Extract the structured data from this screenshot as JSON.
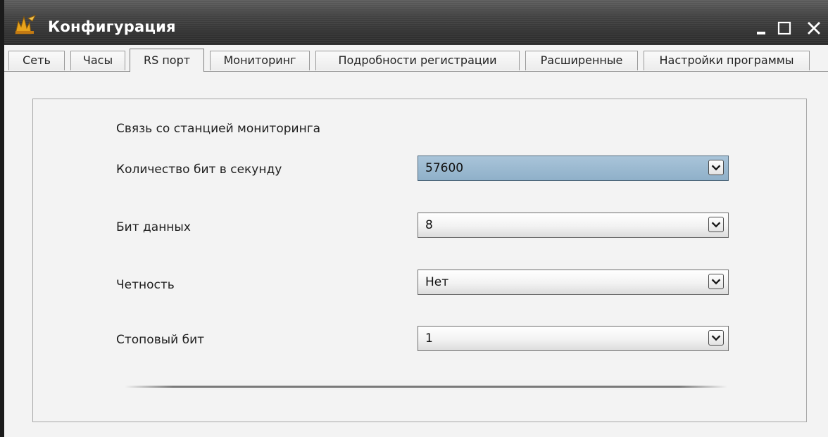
{
  "window": {
    "title": "Конфигурация",
    "accent_color": "#2b2b2b"
  },
  "tabs": [
    {
      "label": "Сеть",
      "active": false
    },
    {
      "label": "Часы",
      "active": false
    },
    {
      "label": "RS порт",
      "active": true
    },
    {
      "label": "Мониторинг",
      "active": false
    },
    {
      "label": "Подробности регистрации",
      "active": false
    },
    {
      "label": "Расширенные",
      "active": false
    },
    {
      "label": "Настройки программы",
      "active": false
    }
  ],
  "section": {
    "heading": "Связь со станцией мониторинга"
  },
  "fields": [
    {
      "label": "Количество бит в секунду",
      "value": "57600",
      "focused": true
    },
    {
      "label": "Бит данных",
      "value": "8",
      "focused": false
    },
    {
      "label": "Четность",
      "value": "Нет",
      "focused": false
    },
    {
      "label": "Стоповый бит",
      "value": "1",
      "focused": false
    }
  ],
  "icons": {
    "app": "app-logo-icon",
    "minimize": "minimize-icon",
    "maximize": "maximize-icon",
    "close": "close-icon",
    "dropdown": "chevron-down-icon"
  }
}
